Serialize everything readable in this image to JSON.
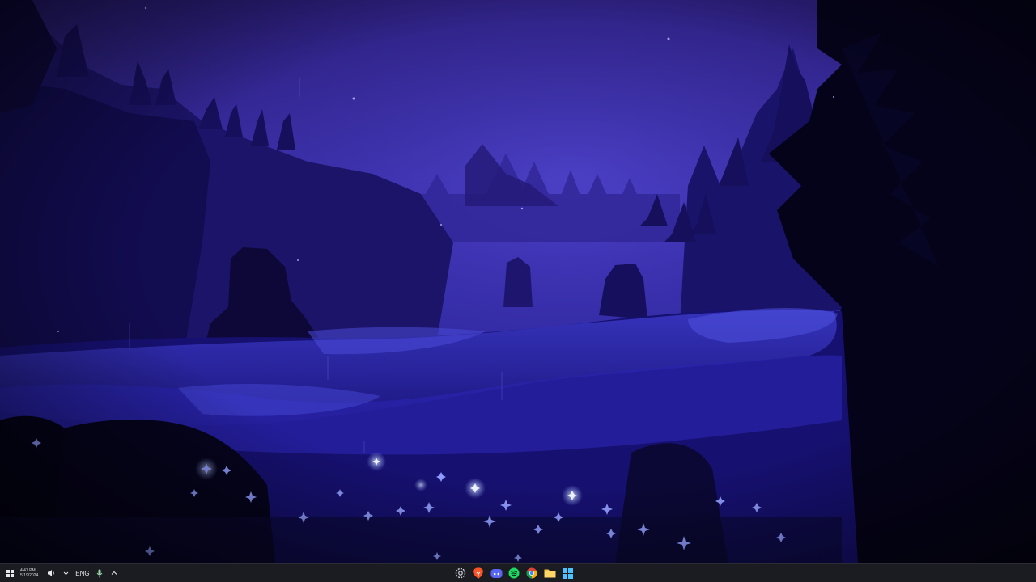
{
  "wallpaper": {
    "colors": {
      "sky_top": "#3a2a9a",
      "sky_mid": "#3528a6",
      "fog": "#4a40c8",
      "meadow": "#2a239a",
      "foreground": "#050418",
      "flowers": "#7f8cff",
      "glow": "#cfe4ff"
    }
  },
  "taskbar": {
    "background": "#1b1b22",
    "clock": {
      "time": "4:47 PM",
      "date": "5/19/2024"
    },
    "language": "ENG",
    "tray_icons": [
      "windows-logo",
      "speaker-icon",
      "chevron-down-icon",
      "microphone-icon",
      "chevron-up-icon"
    ],
    "apps": [
      {
        "name": "settings",
        "icon": "gear-icon"
      },
      {
        "name": "brave",
        "icon": "brave-lion-icon"
      },
      {
        "name": "discord",
        "icon": "discord-icon"
      },
      {
        "name": "spotify",
        "icon": "spotify-icon"
      },
      {
        "name": "chrome",
        "icon": "chrome-icon"
      },
      {
        "name": "file-explorer",
        "icon": "folder-icon"
      },
      {
        "name": "start",
        "icon": "windows-start-icon"
      }
    ]
  }
}
